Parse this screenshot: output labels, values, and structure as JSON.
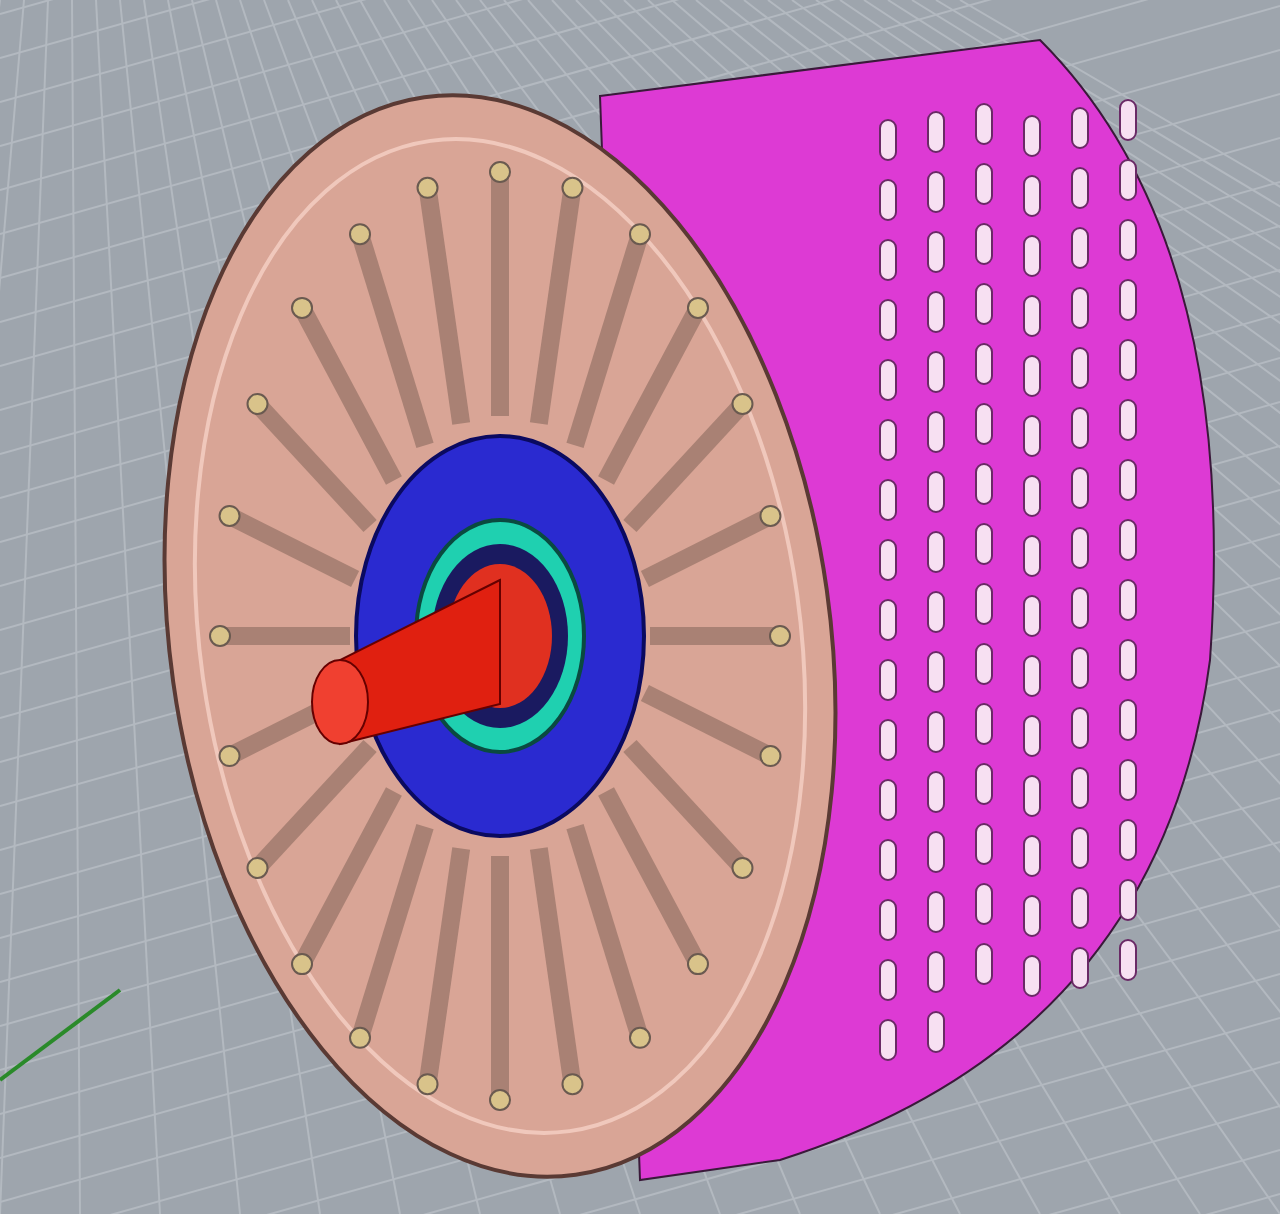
{
  "viewport": {
    "kind": "perspective",
    "grid_visible": true
  }
}
